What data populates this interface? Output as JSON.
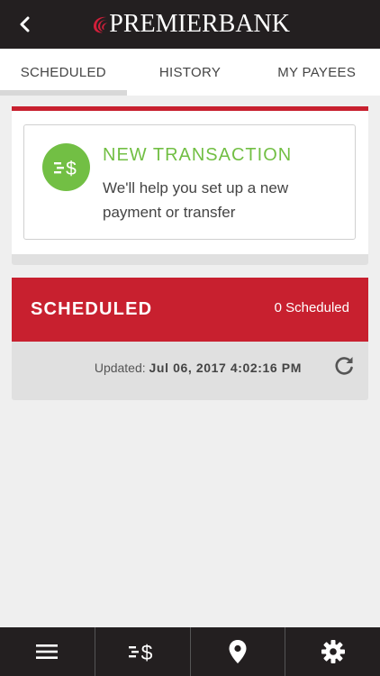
{
  "header": {
    "logo_text_a": "PREMIER",
    "logo_text_b": "BANK",
    "back_icon": "chevron-left-icon"
  },
  "tabs": [
    {
      "label": "SCHEDULED",
      "active": true
    },
    {
      "label": "HISTORY",
      "active": false
    },
    {
      "label": "MY PAYEES",
      "active": false
    }
  ],
  "new_transaction": {
    "title": "NEW TRANSACTION",
    "description": "We'll help you set up a new payment or transfer",
    "icon": "transfer-dollar-icon"
  },
  "scheduled": {
    "title": "SCHEDULED",
    "count_label": "0 Scheduled",
    "updated_label": "Updated:",
    "updated_value": "Jul 06, 2017 4:02:16 PM",
    "refresh_icon": "refresh-icon"
  },
  "bottom_nav": [
    {
      "icon": "menu-icon"
    },
    {
      "icon": "transfer-dollar-icon"
    },
    {
      "icon": "location-pin-icon"
    },
    {
      "icon": "gear-icon"
    }
  ],
  "colors": {
    "brand_red": "#c8202f",
    "accent_green": "#72bf44",
    "dark_bar": "#231f20"
  }
}
